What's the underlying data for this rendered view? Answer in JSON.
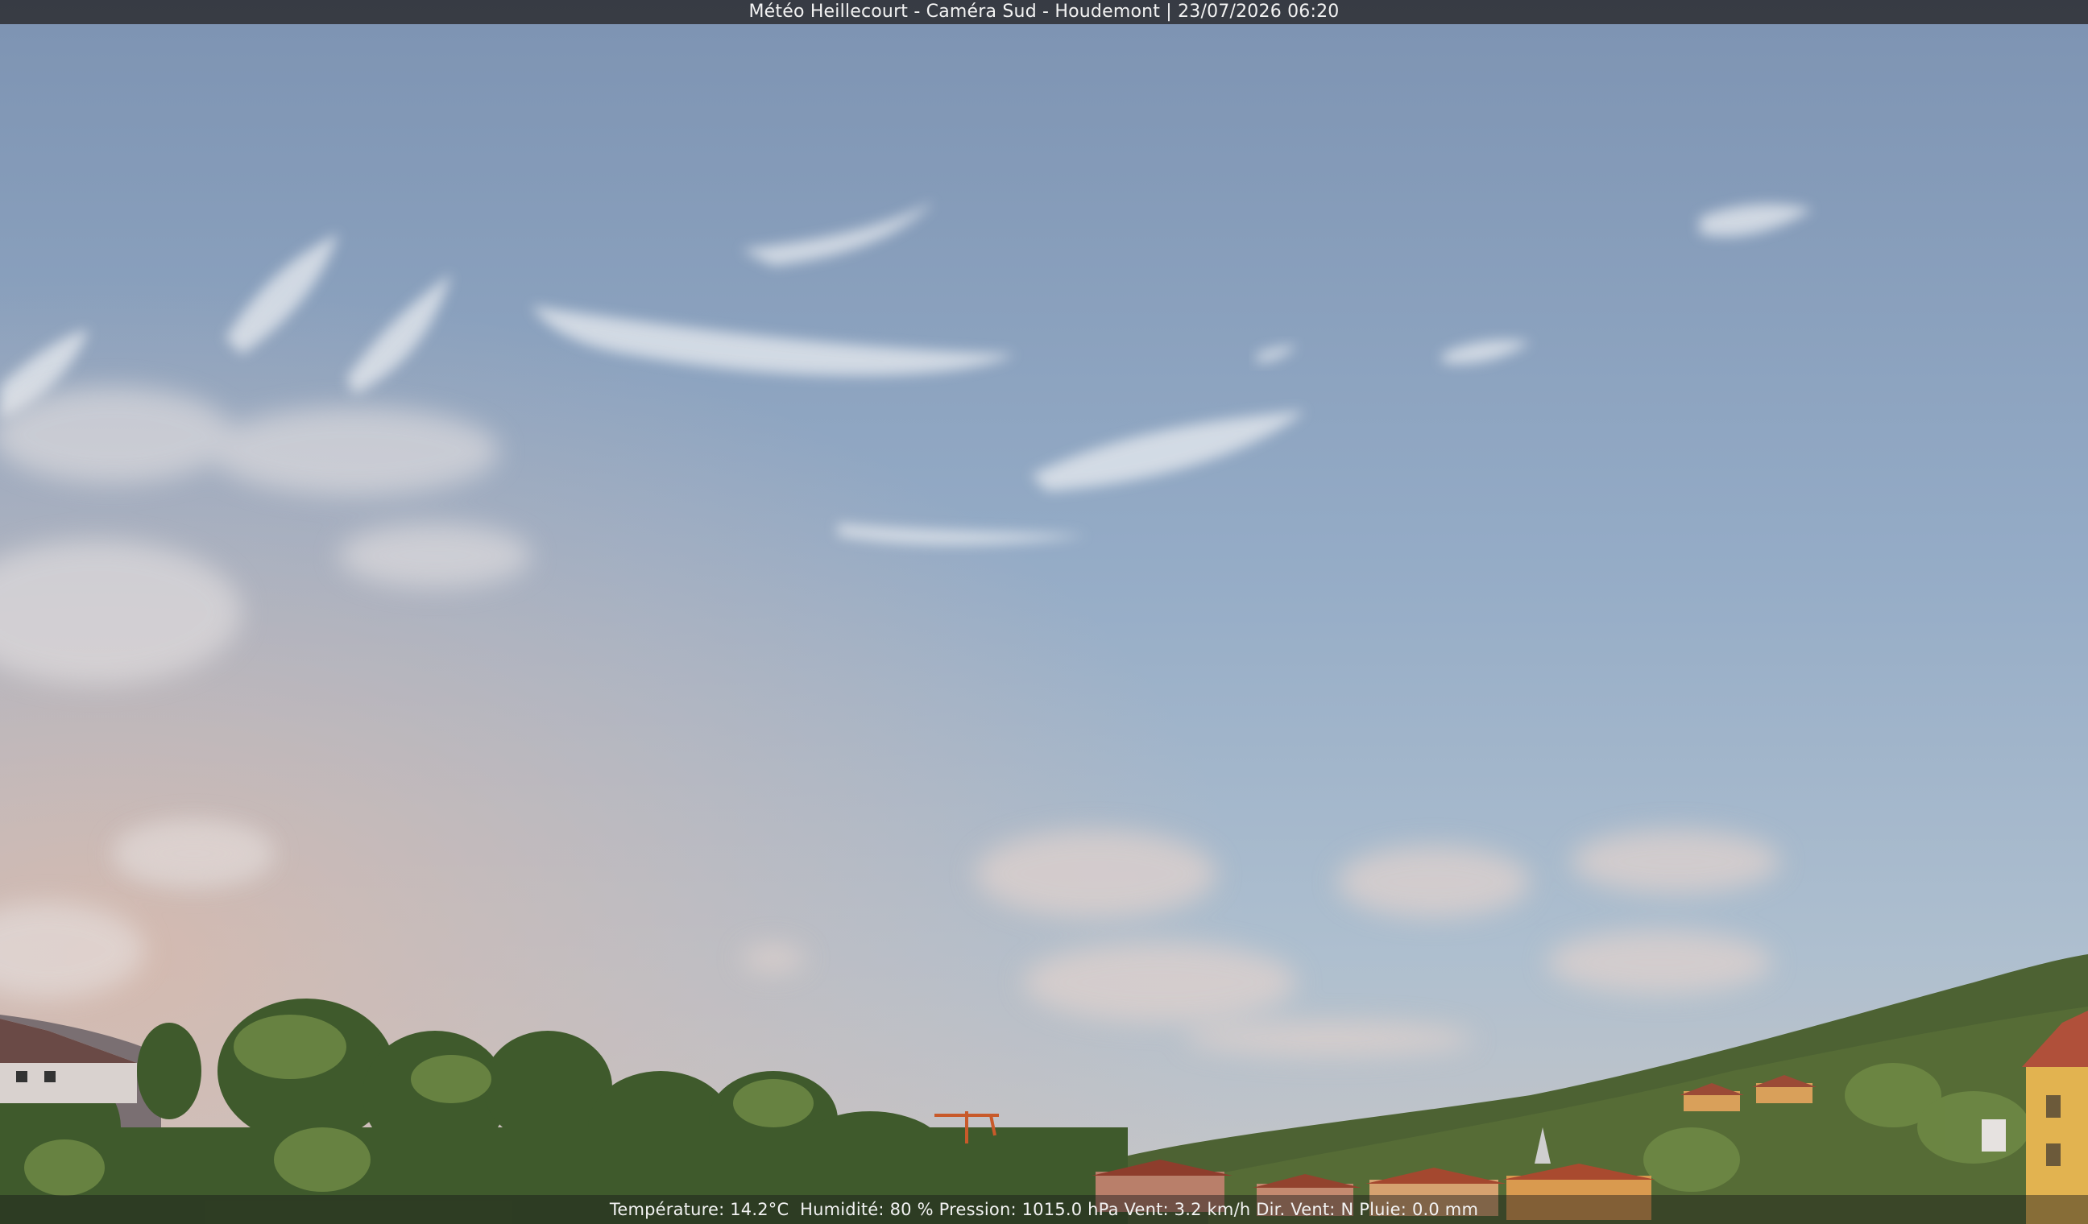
{
  "header": {
    "caption": "Météo Heillecourt - Caméra Sud - Houdemont | 23/07/2026 06:20"
  },
  "footer": {
    "readout": "Température: 14.2°C  Humidité: 80 % Pression: 1015.0 hPa Vent: 3.2 km/h Dir. Vent: N Pluie: 0.0 mm"
  },
  "colors": {
    "sky_top": "#7f96b4",
    "sky_mid": "#97aec8",
    "sky_horizon": "#c3bfc0",
    "haze_pink": "#d8b8a8",
    "foliage": "#3f5a2c",
    "foliage_light": "#6f8a45",
    "roof": "#9b4a36",
    "house_yellow": "#e2b350"
  }
}
